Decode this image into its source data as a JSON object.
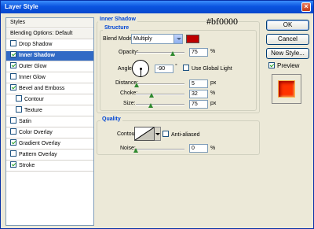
{
  "window": {
    "title": "Layer Style",
    "close_glyph": "×"
  },
  "style_list": {
    "items": [
      {
        "label": "Styles",
        "checkbox": false,
        "checked": false,
        "kind": "header"
      },
      {
        "label": "Blending Options: Default",
        "checkbox": false,
        "checked": false,
        "kind": "header"
      },
      {
        "label": "Drop Shadow",
        "checkbox": true,
        "checked": false
      },
      {
        "label": "Inner Shadow",
        "checkbox": true,
        "checked": true,
        "selected": true
      },
      {
        "label": "Outer Glow",
        "checkbox": true,
        "checked": true
      },
      {
        "label": "Inner Glow",
        "checkbox": true,
        "checked": false
      },
      {
        "label": "Bevel and Emboss",
        "checkbox": true,
        "checked": true
      },
      {
        "label": "Contour",
        "checkbox": true,
        "checked": false,
        "indent": true
      },
      {
        "label": "Texture",
        "checkbox": true,
        "checked": false,
        "indent": true
      },
      {
        "label": "Satin",
        "checkbox": true,
        "checked": false
      },
      {
        "label": "Color Overlay",
        "checkbox": true,
        "checked": false
      },
      {
        "label": "Gradient Overlay",
        "checkbox": true,
        "checked": true
      },
      {
        "label": "Pattern Overlay",
        "checkbox": true,
        "checked": false
      },
      {
        "label": "Stroke",
        "checkbox": true,
        "checked": true
      }
    ]
  },
  "panel": {
    "section_title": "Inner Shadow",
    "structure_title": "Structure",
    "annotation": "#bf0000",
    "blend_mode": {
      "label": "Blend Mode:",
      "value": "Multiply",
      "color": "#bf0000"
    },
    "opacity": {
      "label": "Opacity:",
      "value": "75",
      "unit": "%",
      "level": 0.75
    },
    "angle": {
      "label": "Angle:",
      "value": "-90",
      "unit": "°",
      "global_light_label": "Use Global Light",
      "global_light": false
    },
    "distance": {
      "label": "Distance:",
      "value": "5",
      "unit": "px",
      "level": 0.02
    },
    "choke": {
      "label": "Choke:",
      "value": "32",
      "unit": "%",
      "level": 0.32
    },
    "size": {
      "label": "Size:",
      "value": "75",
      "unit": "px",
      "level": 0.3
    },
    "quality_title": "Quality",
    "contour": {
      "label": "Contour:",
      "anti_aliased_label": "Anti-aliased",
      "anti_aliased": false
    },
    "noise": {
      "label": "Noise:",
      "value": "0",
      "unit": "%",
      "level": 0
    }
  },
  "buttons": {
    "ok": "OK",
    "cancel": "Cancel",
    "new_style": "New Style...",
    "preview": "Preview",
    "preview_checked": true
  }
}
